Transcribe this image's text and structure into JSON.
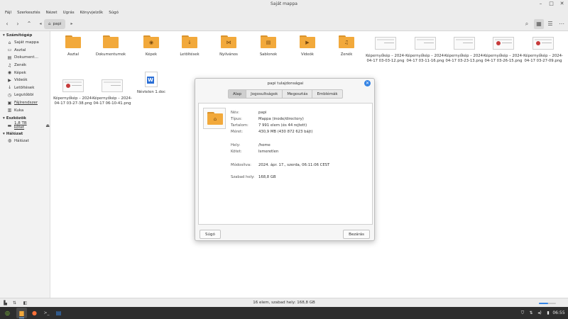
{
  "window": {
    "title": "Saját mappa",
    "controls": [
      "–",
      "□",
      "✕"
    ]
  },
  "menubar": [
    "Fájl",
    "Szerkesztés",
    "Nézet",
    "Ugrás",
    "Könyvjelzők",
    "Súgó"
  ],
  "toolbar": {
    "back": "‹",
    "forward": "›",
    "up": "⌃",
    "crumb_prev": "◂",
    "crumb_next": "▸",
    "breadcrumb": "papi",
    "view_icons": [
      "⌕",
      "▦",
      "☰",
      "⋯"
    ]
  },
  "sidebar": {
    "sections": [
      {
        "title": "Számítógép",
        "items": [
          {
            "label": "Saját mappa",
            "icon": "home-icon"
          },
          {
            "label": "Asztal",
            "icon": "desktop-icon"
          },
          {
            "label": "Dokument…",
            "icon": "documents-icon"
          },
          {
            "label": "Zenék",
            "icon": "music-icon"
          },
          {
            "label": "Képek",
            "icon": "pictures-icon"
          },
          {
            "label": "Videók",
            "icon": "videos-icon"
          },
          {
            "label": "Letöltések",
            "icon": "downloads-icon"
          },
          {
            "label": "Legutóbbi",
            "icon": "recent-icon"
          },
          {
            "label": "Fájlrendszer",
            "icon": "filesystem-icon"
          },
          {
            "label": "Kuka",
            "icon": "trash-icon"
          }
        ]
      },
      {
        "title": "Eszközök",
        "items": [
          {
            "label": "1,8 TB kötet",
            "icon": "drive-icon"
          }
        ]
      },
      {
        "title": "Hálózat",
        "items": [
          {
            "label": "Hálózat",
            "icon": "network-icon"
          }
        ]
      }
    ]
  },
  "files": [
    {
      "name": "Asztal",
      "kind": "folder",
      "emblem": ""
    },
    {
      "name": "Dokumentumok",
      "kind": "folder",
      "emblem": ""
    },
    {
      "name": "Képek",
      "kind": "folder",
      "emblem": "◉"
    },
    {
      "name": "Letöltések",
      "kind": "folder",
      "emblem": "↓"
    },
    {
      "name": "Nyilvános",
      "kind": "folder",
      "emblem": "⋈"
    },
    {
      "name": "Sablonok",
      "kind": "folder",
      "emblem": "▤"
    },
    {
      "name": "Videók",
      "kind": "folder",
      "emblem": "▶"
    },
    {
      "name": "Zenék",
      "kind": "folder",
      "emblem": "♫"
    },
    {
      "name": "Képernyőkép – 2024-04-17 03-03-12.png",
      "kind": "image"
    },
    {
      "name": "Képernyőkép – 2024-04-17 03-11-16.png",
      "kind": "image"
    },
    {
      "name": "Képernyőkép – 2024-04-17 03-23-13.png",
      "kind": "image"
    },
    {
      "name": "Képernyőkép – 2024-04-17 03-26-15.png",
      "kind": "image"
    },
    {
      "name": "Képernyőkép – 2024-04-17 03-27-09.png",
      "kind": "image"
    },
    {
      "name": "Képernyőkép – 2024-04-17 03-27-38.png",
      "kind": "image"
    },
    {
      "name": "Képernyőkép – 2024-04-17 06-10-41.png",
      "kind": "image"
    },
    {
      "name": "Névtelen 1.doc",
      "kind": "doc"
    }
  ],
  "statusbar": {
    "text": "16 elem, szabad hely: 168,8 GB",
    "zoom_fraction": 0.55
  },
  "dialog": {
    "title": "papi tulajdonságai",
    "tabs": [
      "Alap",
      "Jogosultságok",
      "Megosztás",
      "Emblémák"
    ],
    "active_tab": "Alap",
    "props": [
      {
        "label": "Név:",
        "value": "papi"
      },
      {
        "label": "Típus:",
        "value": "Mappa (inode/directory)"
      },
      {
        "label": "Tartalom:",
        "value": "7 991 elem (és 44 rejtett)"
      },
      {
        "label": "Méret:",
        "value": "430,9 MB (430 872 623 bájt)"
      },
      {
        "label": "Hely:",
        "value": "/home"
      },
      {
        "label": "Kötet:",
        "value": "Ismeretlen"
      },
      {
        "label": "Módosítva:",
        "value": "2024. ápr. 17., szerda, 06:11:06 CEST"
      },
      {
        "label": "Szabad hely:",
        "value": "168,8 GB"
      }
    ],
    "help_button": "Súgó",
    "close_button": "Bezárás"
  },
  "taskbar": {
    "time": "06:55",
    "tray_icons": [
      "shield-icon",
      "network-icon",
      "volume-icon",
      "battery-icon"
    ]
  },
  "colors": {
    "accent": "#3584e4",
    "folder": "#f2a93b"
  }
}
